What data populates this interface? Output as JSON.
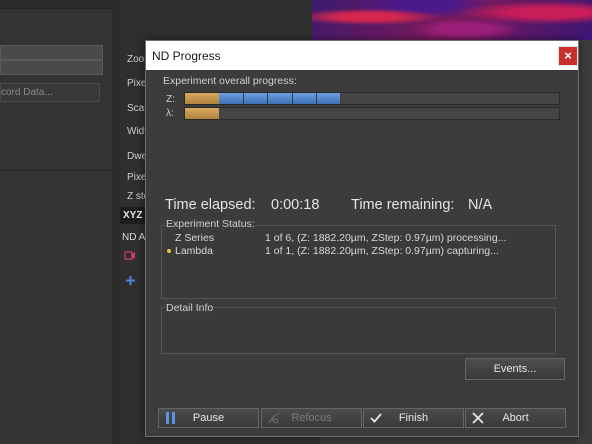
{
  "background": {
    "left_panel": {
      "record_button": "cord Data..."
    },
    "mid_panel": {
      "labels": [
        "Zoom",
        "Pixel",
        "Scan",
        "Widt",
        "Dwel",
        "Pixel",
        "Z ste"
      ],
      "section_header": "XYZ",
      "nd_acq_label": "ND Ac"
    }
  },
  "dialog": {
    "title": "ND Progress",
    "close_symbol": "×",
    "overall_label": "Experiment overall progress:",
    "progress": [
      {
        "axis": "Z:",
        "completed_steps": 1,
        "total_steps": 6,
        "active_fraction": 0.6
      },
      {
        "axis": "λ:",
        "completed_steps": 1,
        "total_steps": 1,
        "active_fraction": 0.0
      }
    ],
    "time_elapsed_label": "Time elapsed:",
    "time_elapsed_value": "0:00:18",
    "time_remaining_label": "Time remaining:",
    "time_remaining_value": "N/A",
    "status_title": "Experiment Status:",
    "status_rows": [
      {
        "name": "Z Series",
        "detail": "1 of 6, (Z: 1882.20µm, ZStep: 0.97µm) processing...",
        "active": false
      },
      {
        "name": "Lambda",
        "detail": "1 of 1, (Z: 1882.20µm, ZStep: 0.97µm) capturing...",
        "active": true
      }
    ],
    "detail_title": "Detail Info",
    "events_button": "Events...",
    "footer_buttons": {
      "pause": "Pause",
      "refocus": "Refocus",
      "finish": "Finish",
      "abort": "Abort"
    },
    "colors": {
      "accent_blue": "#4a7fc7",
      "completed_orange": "#c8964c",
      "close_red": "#c8302e",
      "active_bullet": "#e8c340"
    }
  }
}
